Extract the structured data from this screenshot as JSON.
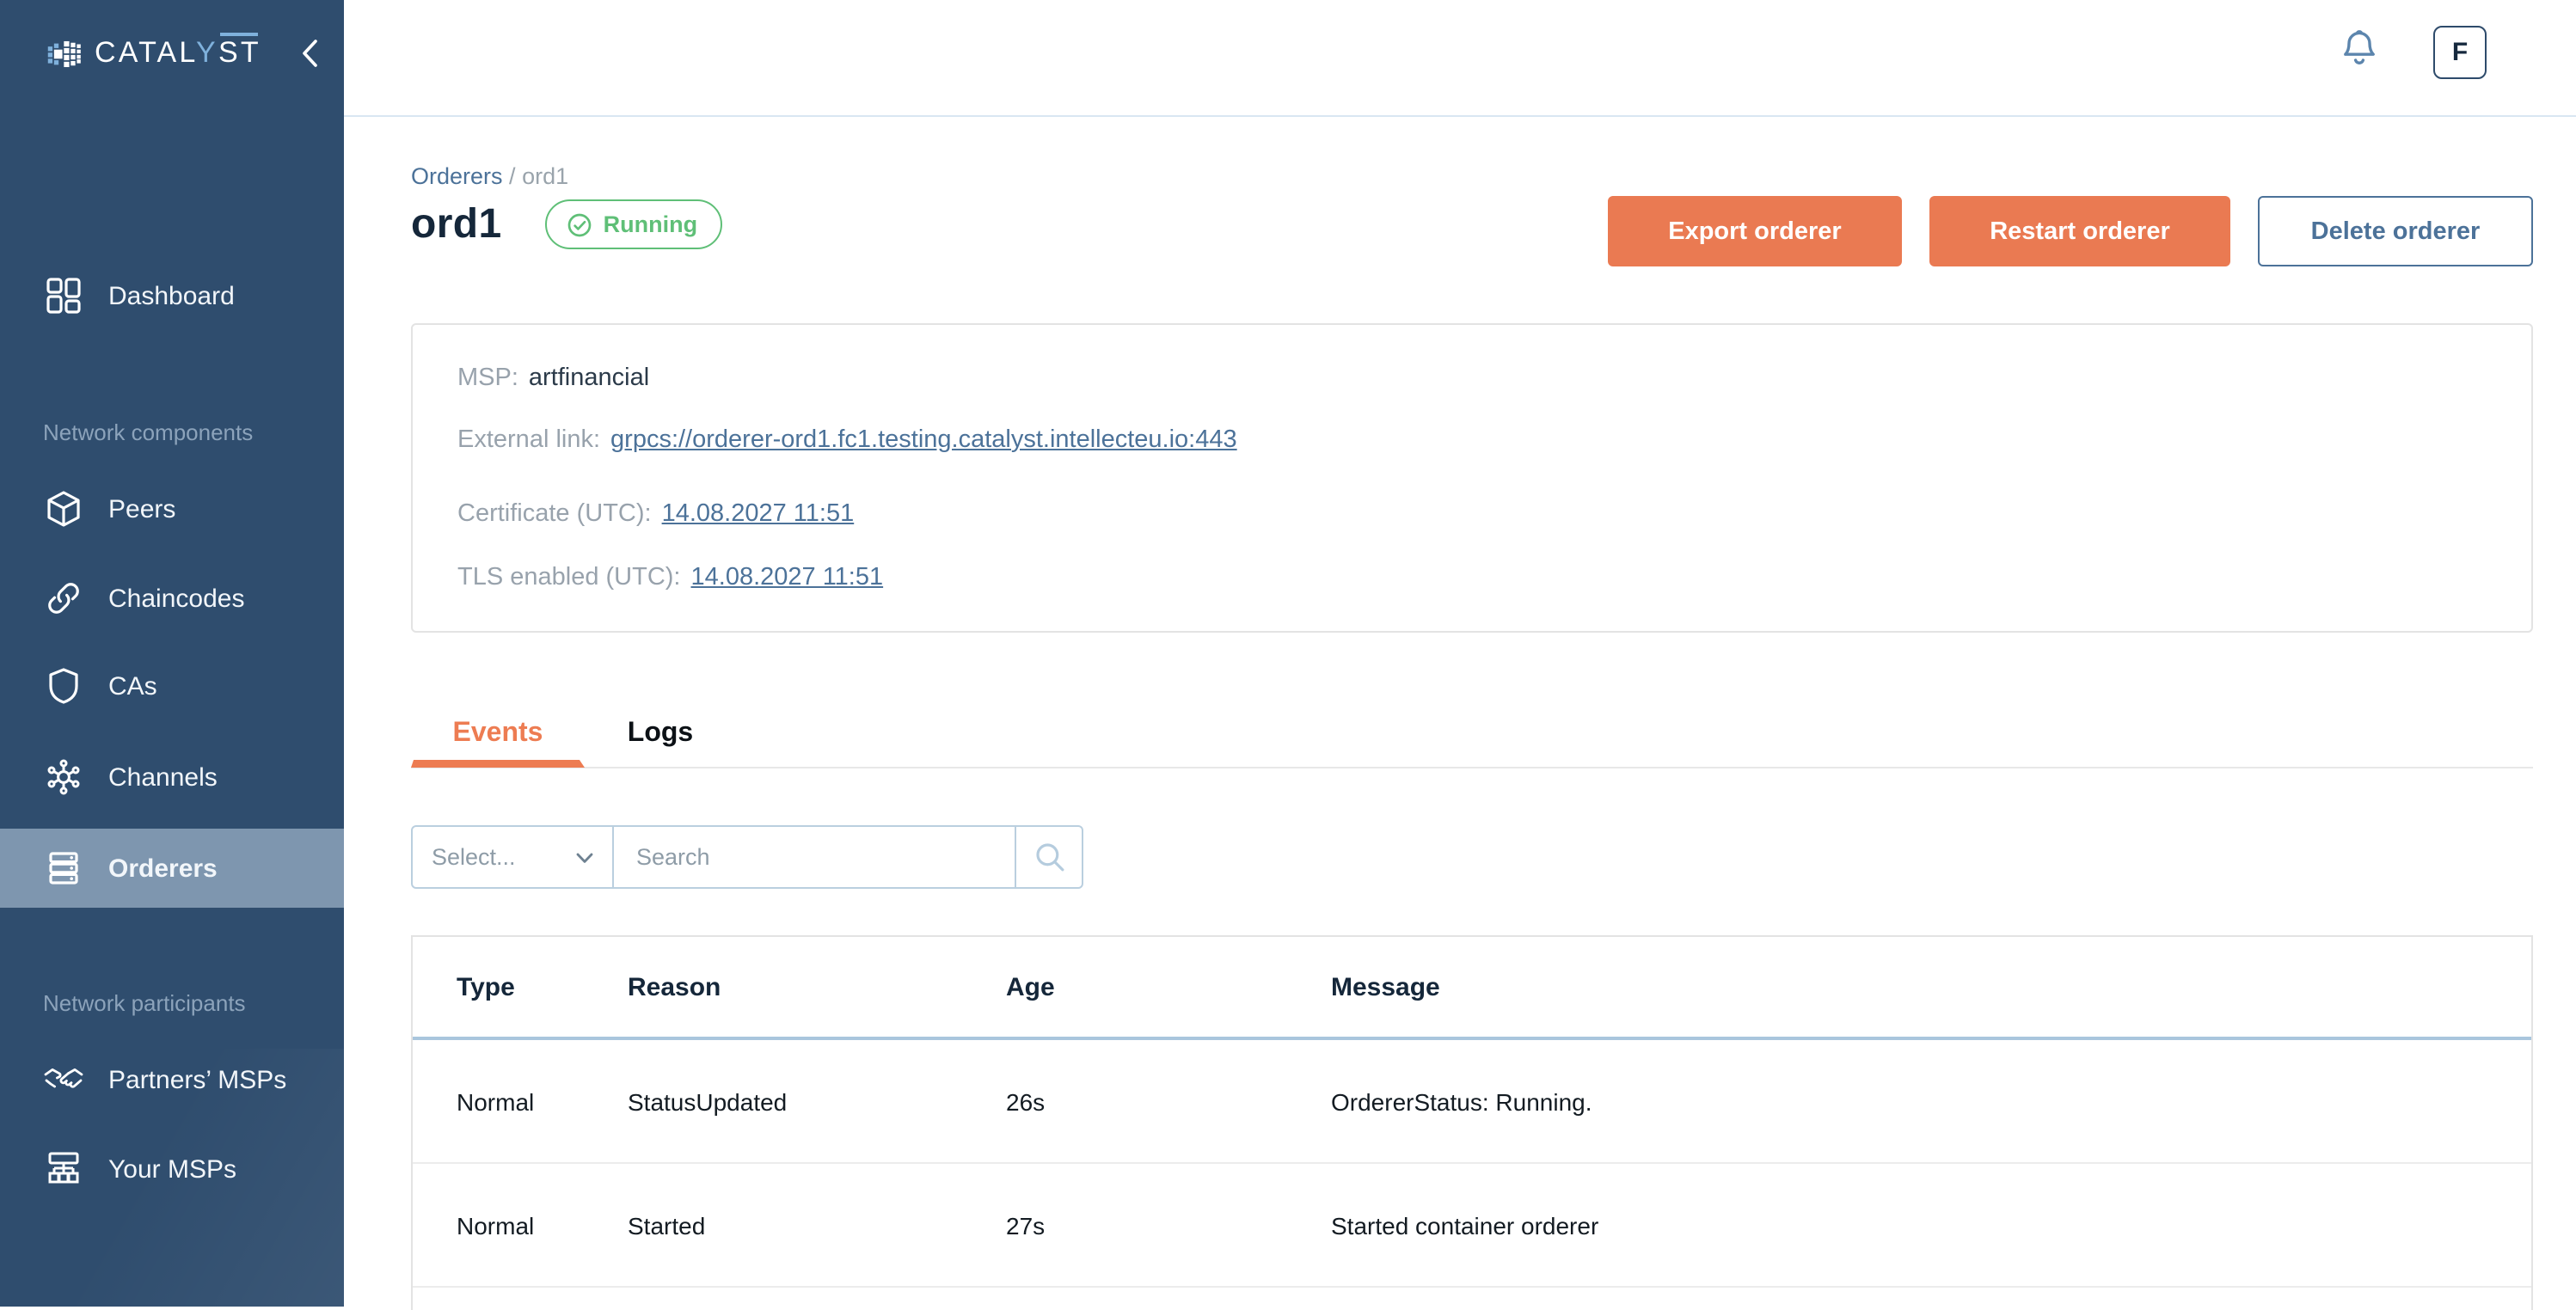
{
  "colors": {
    "sidebar_bg": "#2F4D6E",
    "active_item_bg": "#7E96AF",
    "accent_orange": "#EA7A52",
    "link_blue": "#4C7299",
    "status_green": "#5FBF77",
    "logo_blue": "#7FB1DC"
  },
  "sidebar": {
    "logo": {
      "part1": "CATAL",
      "part2": "Y",
      "part3": "ST"
    },
    "sections": [
      {
        "label": "",
        "items": [
          {
            "label": "Dashboard",
            "icon": "dashboard-icon",
            "active": false
          }
        ]
      },
      {
        "label": "Network components",
        "items": [
          {
            "label": "Peers",
            "icon": "cube-icon",
            "active": false
          },
          {
            "label": "Chaincodes",
            "icon": "link-icon",
            "active": false
          },
          {
            "label": "CAs",
            "icon": "shield-icon",
            "active": false
          },
          {
            "label": "Channels",
            "icon": "hub-icon",
            "active": false
          },
          {
            "label": "Orderers",
            "icon": "server-icon",
            "active": true
          }
        ]
      },
      {
        "label": "Network participants",
        "items": [
          {
            "label": "Partners’ MSPs",
            "icon": "handshake-icon",
            "active": false
          },
          {
            "label": "Your MSPs",
            "icon": "org-chart-icon",
            "active": false
          }
        ]
      }
    ]
  },
  "header": {
    "avatar_initial": "F"
  },
  "page": {
    "breadcrumb": {
      "parent": "Orderers",
      "separator": " / ",
      "current": "ord1"
    },
    "title": "ord1",
    "status": "Running",
    "actions": {
      "export_label": "Export orderer",
      "restart_label": "Restart orderer",
      "delete_label": "Delete orderer"
    }
  },
  "details": {
    "msp_label": "MSP:",
    "msp_value": "artfinancial",
    "external_link_label": "External link:",
    "external_link_value": "grpcs://orderer-ord1.fc1.testing.catalyst.intellecteu.io:443",
    "certificate_label": "Certificate (UTC):",
    "certificate_value": "14.08.2027 11:51",
    "tls_label": "TLS enabled (UTC):",
    "tls_value": "14.08.2027 11:51"
  },
  "tabs": {
    "events_label": "Events",
    "logs_label": "Logs"
  },
  "filters": {
    "select_placeholder": "Select...",
    "search_placeholder": "Search"
  },
  "events_table": {
    "columns": [
      "Type",
      "Reason",
      "Age",
      "Message"
    ],
    "rows": [
      [
        "Normal",
        "StatusUpdated",
        "26s",
        "OrdererStatus: Running."
      ],
      [
        "Normal",
        "Started",
        "27s",
        "Started container orderer"
      ]
    ]
  }
}
